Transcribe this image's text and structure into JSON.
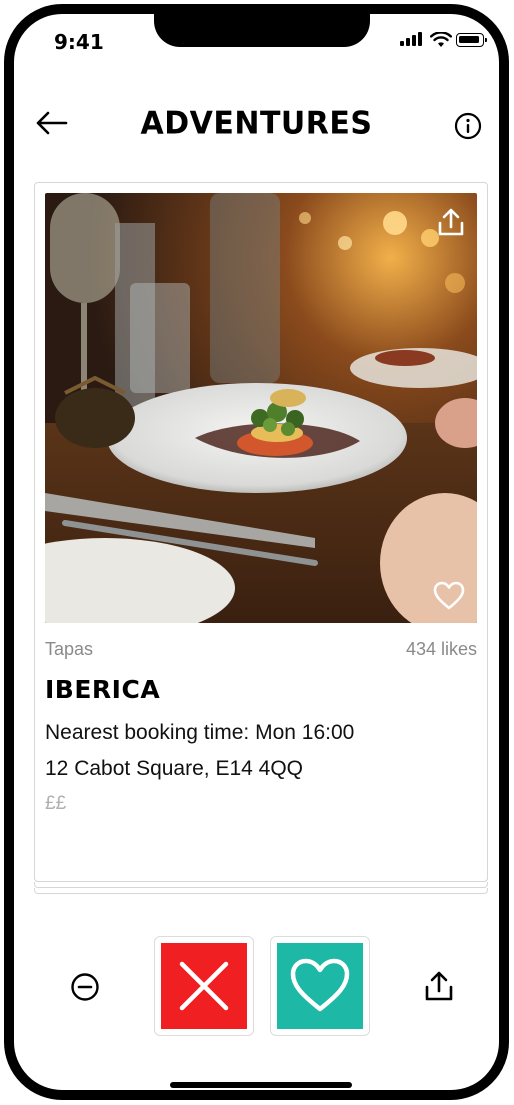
{
  "status_bar": {
    "time": "9:41"
  },
  "header": {
    "title": "ADVENTURES"
  },
  "card": {
    "cuisine": "Tapas",
    "likes": "434 likes",
    "name": "IBERICA",
    "booking": "Nearest booking time: Mon 16:00",
    "address": "12 Cabot Square, E14 4QQ",
    "price": "££"
  },
  "icons": {
    "back": "arrow-left-icon",
    "info": "info-icon",
    "share": "share-icon",
    "heart": "heart-icon",
    "remove": "minus-circle-icon",
    "reject": "close-icon"
  },
  "colors": {
    "reject": "#f01f22",
    "like": "#1db8a6",
    "muted_text": "#8a8a8a"
  }
}
